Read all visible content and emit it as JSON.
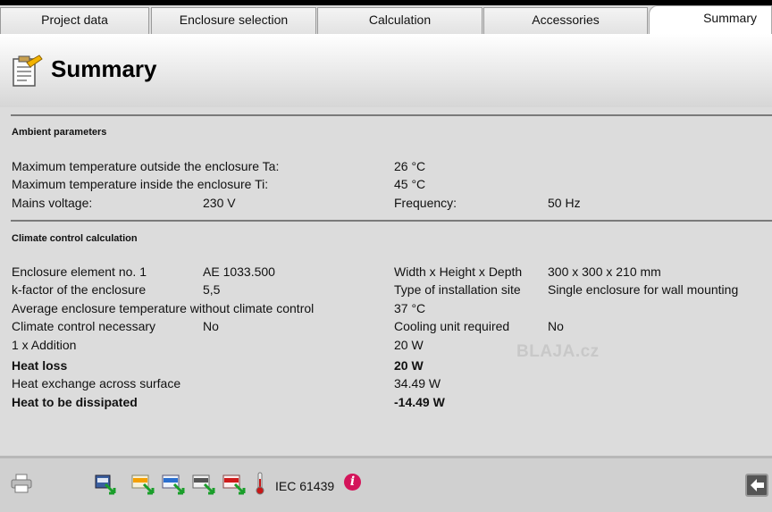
{
  "tabs": [
    {
      "label": "Project data"
    },
    {
      "label": "Enclosure selection"
    },
    {
      "label": "Calculation"
    },
    {
      "label": "Accessories"
    },
    {
      "label": "Summary"
    }
  ],
  "page_title": "Summary",
  "ambient": {
    "heading": "Ambient parameters",
    "max_outside_label": "Maximum temperature outside the enclosure Ta:",
    "max_outside_value": "26 °C",
    "max_inside_label": "Maximum temperature inside the enclosure Ti:",
    "max_inside_value": "45 °C",
    "mains_label": "Mains voltage:",
    "mains_value": "230 V",
    "frequency_label": "Frequency:",
    "frequency_value": "50 Hz"
  },
  "climate": {
    "heading": "Climate control calculation",
    "element_label": "Enclosure element no. 1",
    "element_value": "AE 1033.500",
    "whd_label": "Width x Height x Depth",
    "whd_value": "300 x 300 x 210 mm",
    "kfactor_label": "k-factor of the enclosure",
    "kfactor_value": "5,5",
    "site_label": "Type of installation site",
    "site_value": "Single enclosure for wall mounting",
    "avg_temp_label": "Average enclosure temperature without climate control",
    "avg_temp_value": "37 °C",
    "necessary_label": "Climate control necessary",
    "necessary_value": "No",
    "cooling_label": "Cooling unit required",
    "cooling_value": "No",
    "addition_label": "1 x Addition",
    "addition_value": "20 W",
    "heat_loss_label": "Heat loss",
    "heat_loss_value": "20 W",
    "exchange_label": "Heat exchange across surface",
    "exchange_value": "34.49 W",
    "dissipated_label": "Heat to be dissipated",
    "dissipated_value": "-14.49 W"
  },
  "watermark": "BLAJA.cz",
  "footer": {
    "iec_label": "IEC 61439",
    "info_glyph": "i",
    "icons": [
      "print-icon",
      "export-sim-icon",
      "export-xml-icon",
      "export-htm-icon",
      "export-txt-icon",
      "export-pdf-icon",
      "thermometer-icon",
      "info-icon",
      "back-icon"
    ]
  }
}
